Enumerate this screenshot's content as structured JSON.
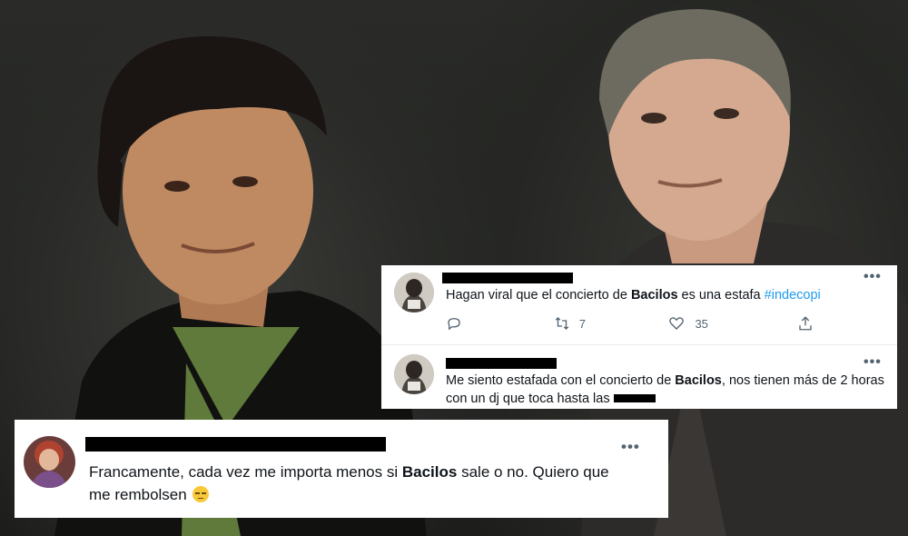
{
  "tweet1": {
    "text_before": "Hagan viral que el concierto de ",
    "bold": "Bacilos",
    "text_after": " es una estafa ",
    "hashtag": "#indecopi",
    "retweets": "7",
    "likes": "35"
  },
  "tweet2": {
    "text_before": "Me siento estafada con el concierto de ",
    "bold": "Bacilos",
    "text_after": ", nos tienen más de 2 horas",
    "line2": "con un dj que toca hasta las "
  },
  "tweet3": {
    "text_before": "Francamente, cada vez me importa menos si ",
    "bold": "Bacilos",
    "text_after": " sale o no. Quiero que",
    "line2": "me rembolsen "
  },
  "icons": {
    "reply": "reply-icon",
    "retweet": "retweet-icon",
    "like": "heart-icon",
    "share": "share-icon",
    "more": "more-icon",
    "emoji": "unamused-face-emoji"
  },
  "colors": {
    "hashtag": "#1d9bf0",
    "muted": "#536471"
  }
}
